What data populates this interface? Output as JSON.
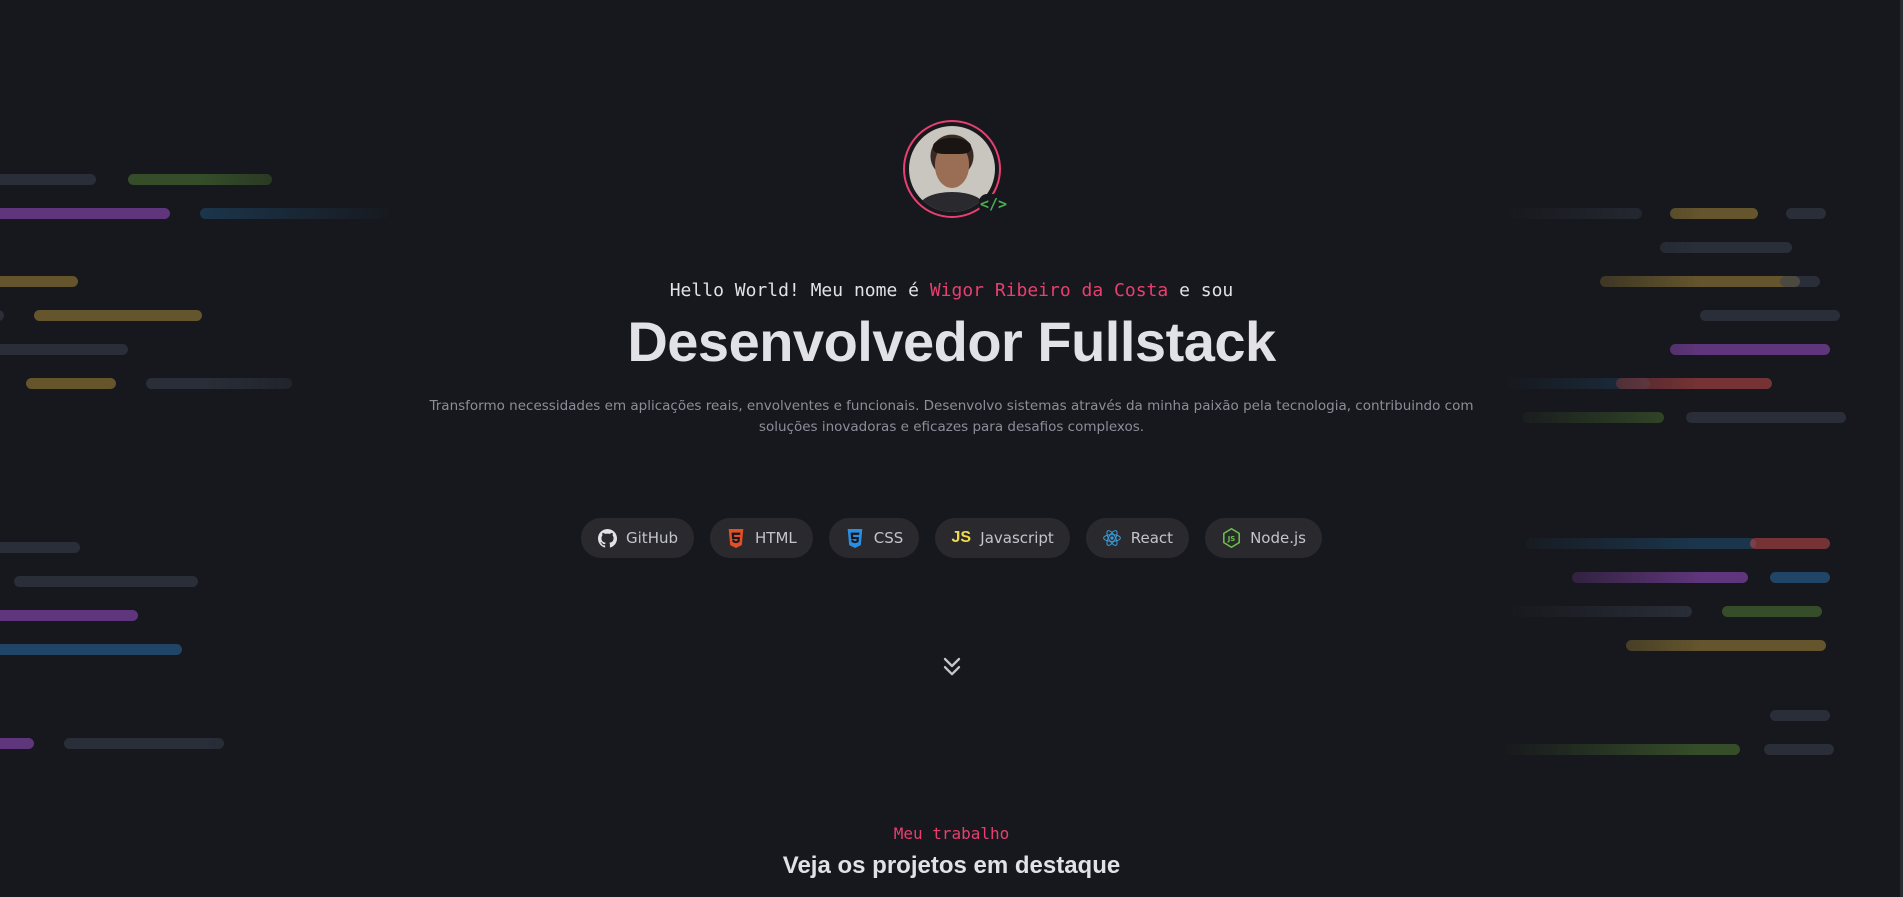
{
  "profile": {
    "avatar_alt": "",
    "badge_symbol": "</>"
  },
  "hero": {
    "greeting_prefix": "Hello World! Meu nome é ",
    "name": "Wigor Ribeiro da Costa",
    "greeting_suffix": " e sou",
    "role": "Desenvolvedor Fullstack",
    "description": "Transformo necessidades em aplicações reais, envolventes e funcionais. Desenvolvo sistemas através da minha paixão pela tecnologia, contribuindo com soluções inovadoras e eficazes para desafios complexos."
  },
  "techs": [
    {
      "label": "GitHub",
      "icon": "github-icon",
      "color": "#e1e1e6"
    },
    {
      "label": "HTML",
      "icon": "html5-icon",
      "color": "#e34f26"
    },
    {
      "label": "CSS",
      "icon": "css3-icon",
      "color": "#2a8fe3"
    },
    {
      "label": "Javascript",
      "icon": "javascript-icon",
      "color": "#f0db4f"
    },
    {
      "label": "React",
      "icon": "react-icon",
      "color": "#3b9cd6"
    },
    {
      "label": "Node.js",
      "icon": "nodejs-icon",
      "color": "#6cc24a"
    }
  ],
  "scroll": {
    "icon": "chevrons-down-icon"
  },
  "next_section": {
    "subtitle": "Meu trabalho",
    "title": "Veja os projetos em destaque"
  },
  "colors": {
    "background": "#17181d",
    "accent": "#e83f6f",
    "chip": "#29292e",
    "muted_text": "#8d8d99"
  }
}
